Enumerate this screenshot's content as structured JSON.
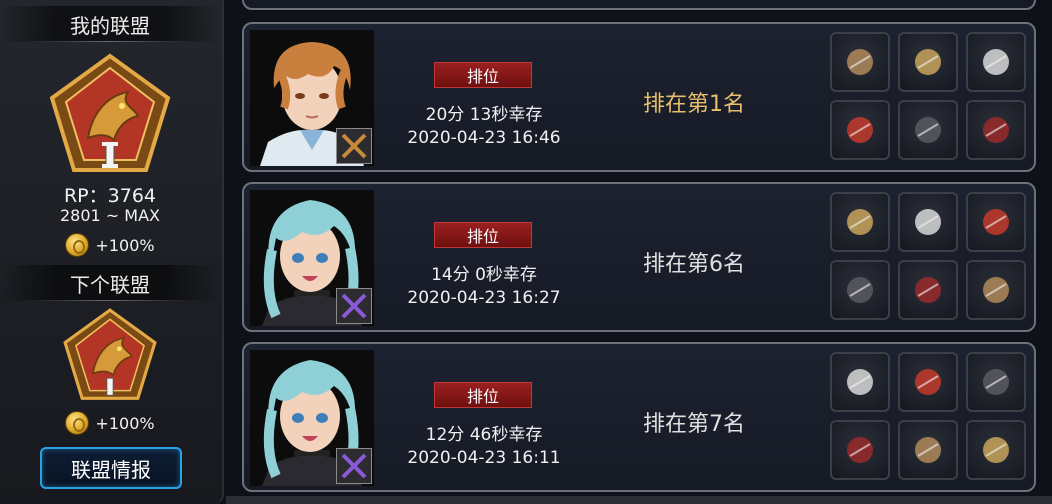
{
  "left_panel": {
    "my_league_title": "我的联盟",
    "rp_label": "RP：3764",
    "rp_range": "2801 ~ MAX",
    "bonus": "+100%",
    "next_league_title": "下个联盟",
    "next_bonus": "+100%",
    "info_button": "联盟情报",
    "emblem_rank": "I"
  },
  "records": [
    {
      "tag": "排位",
      "survive": "20分 13秒幸存",
      "date": "2020-04-23 16:46",
      "place": "排在第1名",
      "highlight": true,
      "hair_color": "#c97f3d",
      "items": [
        "crossbow-icon",
        "helmet-icon",
        "wing-blade-icon",
        "red-jacket-icon",
        "black-gauntlet-icon",
        "red-shoes-icon"
      ]
    },
    {
      "tag": "排位",
      "survive": "14分 0秒幸存",
      "date": "2020-04-23 16:27",
      "place": "排在第6名",
      "highlight": false,
      "hair_color": "#8fd0d6",
      "items": [
        "disc-icon",
        "racing-helmet-icon",
        "chakram-icon",
        "dark-glove-icon",
        "mech-boots-icon",
        "fire-orb-icon"
      ]
    },
    {
      "tag": "排位",
      "survive": "12分 46秒幸存",
      "date": "2020-04-23 16:11",
      "place": "排在第7名",
      "highlight": false,
      "hair_color": "#8fd0d6",
      "items": [
        "boomerang-icon",
        "helmet-icon",
        "arrowhead-icon",
        "armor-icon",
        "boots-icon",
        "treasure-box-icon"
      ]
    }
  ],
  "colors": {
    "tag_red": "#9b1f1f",
    "gold_text": "#e8bf6a",
    "button_blue": "#2aa3e6"
  }
}
